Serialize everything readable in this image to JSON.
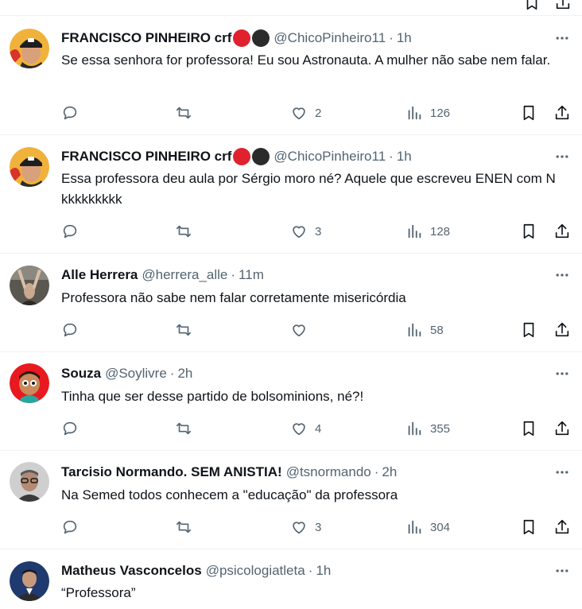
{
  "tweets": [
    {
      "name": "FRANCISCO PINHEIRO crf",
      "handle": "@ChicoPinheiro11",
      "time": "1h",
      "text": "Se essa senhora for professora! Eu sou Astronauta. A mulher não sabe nem falar.",
      "likes": "2",
      "views": "126",
      "badges": [
        "#e0212e",
        "#2b2b2b"
      ],
      "avatar_icon": "man-cap-avatar-icon"
    },
    {
      "name": "FRANCISCO PINHEIRO crf",
      "handle": "@ChicoPinheiro11",
      "time": "1h",
      "text": "Essa professora deu aula por Sérgio moro né? Aquele que escreveu ENEN com N kkkkkkkkk",
      "likes": "3",
      "views": "128",
      "badges": [
        "#e0212e",
        "#2b2b2b"
      ],
      "avatar_icon": "man-cap-avatar-icon"
    },
    {
      "name": "Alle Herrera",
      "handle": "@herrera_alle",
      "time": "11m",
      "text": "Professora não sabe nem falar corretamente misericórdia",
      "likes": "",
      "views": "58",
      "badges": [],
      "avatar_icon": "raised-hands-avatar-icon"
    },
    {
      "name": "Souza",
      "handle": "@Soylivre",
      "time": "2h",
      "text": "Tinha que ser desse partido de bolsominions, né?!",
      "likes": "4",
      "views": "355",
      "badges": [],
      "avatar_icon": "cartoon-boy-avatar-icon"
    },
    {
      "name": "Tarcisio Normando. SEM ANISTIA!",
      "handle": "@tsnormando",
      "time": "2h",
      "text": "Na Semed todos conhecem a \"educação\" da professora",
      "likes": "3",
      "views": "304",
      "badges": [],
      "avatar_icon": "man-glasses-avatar-icon"
    },
    {
      "name": "Matheus Vasconcelos",
      "handle": "@psicologiatleta",
      "time": "1h",
      "text": "“Professora”",
      "likes": "",
      "views": "",
      "badges": [],
      "avatar_icon": "man-jacket-avatar-icon"
    }
  ],
  "separator": "·",
  "colors": {
    "text_primary": "#0f1419",
    "text_secondary": "#536471",
    "border": "#eff3f4"
  }
}
